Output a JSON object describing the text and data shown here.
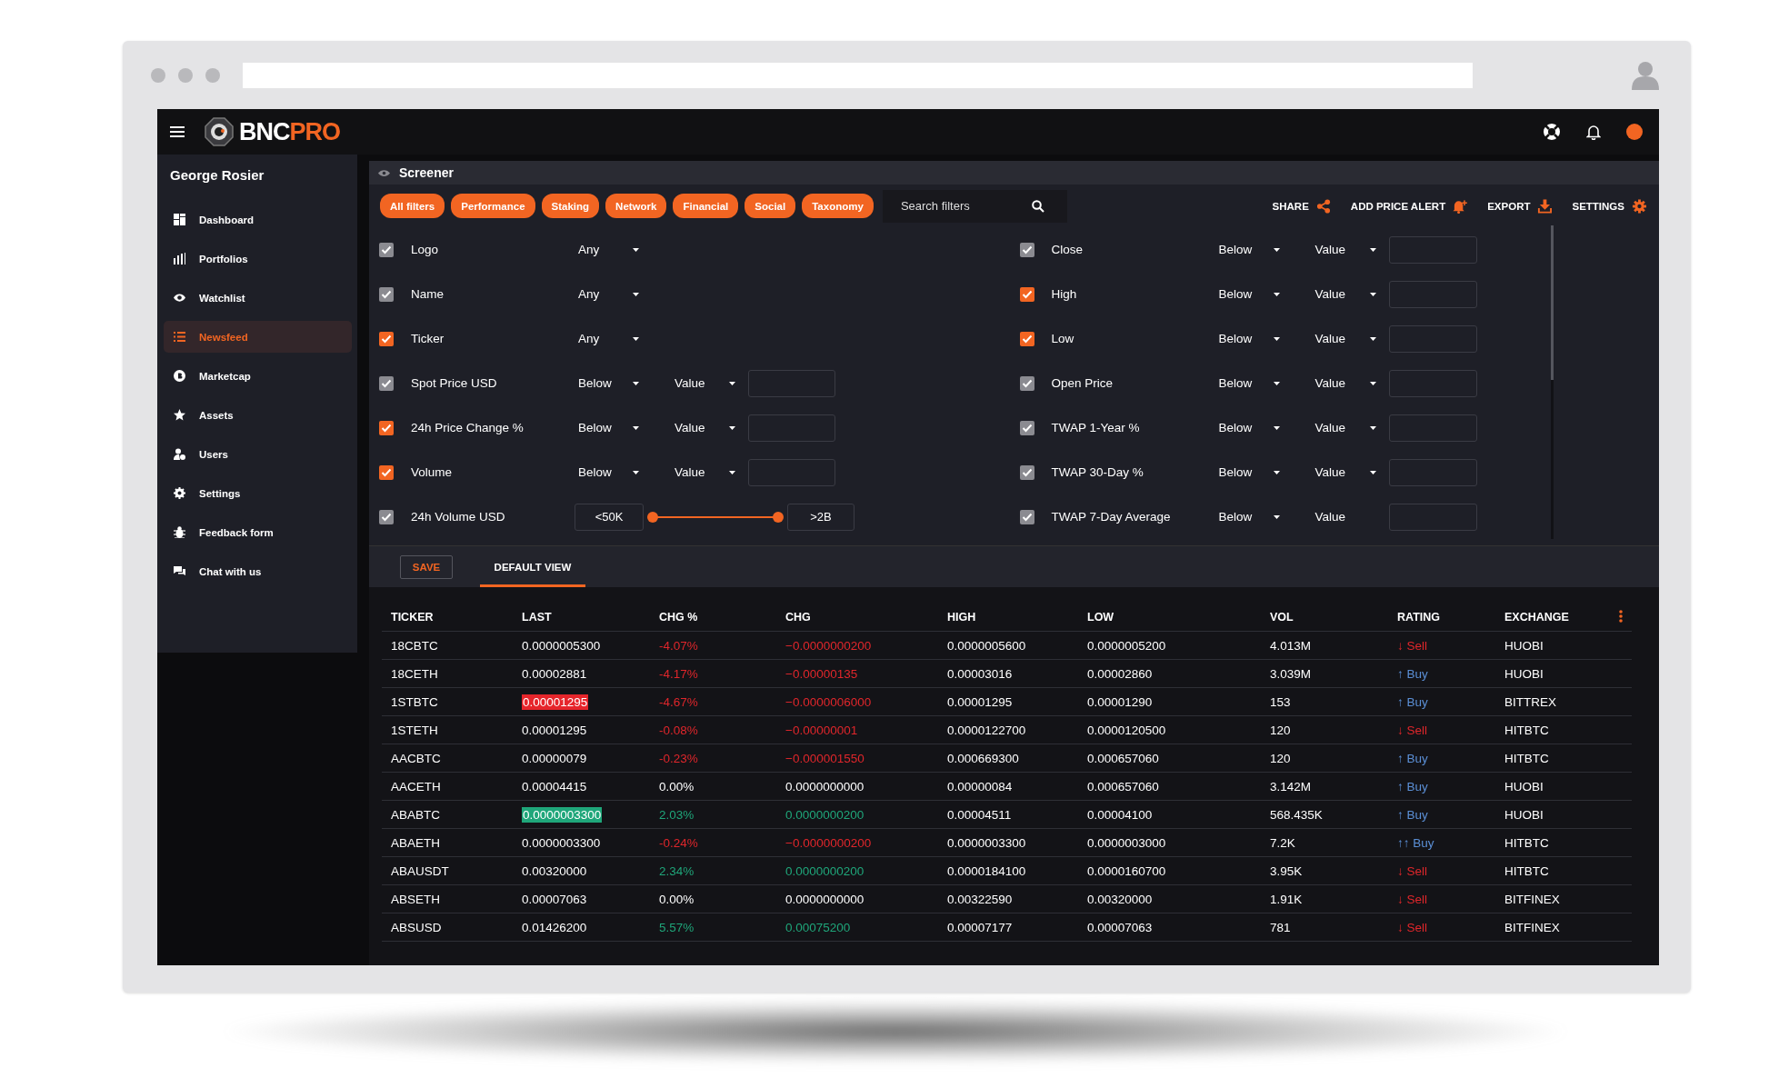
{
  "app": {
    "logo": {
      "primary": "BNC",
      "accent": "PRO"
    }
  },
  "sidebar": {
    "user": "George Rosier",
    "items": [
      {
        "label": "Dashboard",
        "selected": false
      },
      {
        "label": "Portfolios",
        "selected": false
      },
      {
        "label": "Watchlist",
        "selected": false
      },
      {
        "label": "Newsfeed",
        "selected": true
      },
      {
        "label": "Marketcap",
        "selected": false
      },
      {
        "label": "Assets",
        "selected": false
      },
      {
        "label": "Users",
        "selected": false
      },
      {
        "label": "Settings",
        "selected": false
      },
      {
        "label": "Feedback form",
        "selected": false
      },
      {
        "label": "Chat with us",
        "selected": false
      }
    ]
  },
  "screener": {
    "title": "Screener",
    "chips": [
      "All filters",
      "Performance",
      "Staking",
      "Network",
      "Financial",
      "Social",
      "Taxonomy"
    ],
    "search": {
      "placeholder": "Search filters"
    },
    "actions": [
      {
        "label": "SHARE"
      },
      {
        "label": "ADD PRICE ALERT"
      },
      {
        "label": "EXPORT"
      },
      {
        "label": "SETTINGS"
      }
    ],
    "filter_columns": [
      [
        {
          "label": "Logo",
          "checked": true,
          "color": "#8b8b91",
          "kind": "select",
          "op": "Any"
        },
        {
          "label": "Name",
          "checked": true,
          "color": "#8b8b91",
          "kind": "select",
          "op": "Any"
        },
        {
          "label": "Ticker",
          "checked": true,
          "color": "#f26522",
          "kind": "select",
          "op": "Any"
        },
        {
          "label": "Spot Price USD",
          "checked": true,
          "color": "#8b8b91",
          "kind": "compare",
          "op": "Below",
          "value": "Value",
          "value_dropdown": true
        },
        {
          "label": "24h Price Change %",
          "checked": true,
          "color": "#f26522",
          "kind": "compare",
          "op": "Below",
          "value": "Value",
          "value_dropdown": true
        },
        {
          "label": "Volume",
          "checked": true,
          "color": "#f26522",
          "kind": "compare",
          "op": "Below",
          "value": "Value",
          "value_dropdown": true
        },
        {
          "label": "24h Volume USD",
          "checked": true,
          "color": "#8b8b91",
          "kind": "range",
          "min": "<50K",
          "max": ">2B",
          "level": 1
        }
      ],
      [
        {
          "label": "Close",
          "checked": true,
          "color": "#8b8b91",
          "kind": "compare",
          "op": "Below",
          "value": "Value",
          "value_dropdown": true
        },
        {
          "label": "High",
          "checked": true,
          "color": "#f26522",
          "kind": "compare",
          "op": "Below",
          "value": "Value",
          "value_dropdown": true
        },
        {
          "label": "Low",
          "checked": true,
          "color": "#f26522",
          "kind": "compare",
          "op": "Below",
          "value": "Value",
          "value_dropdown": true
        },
        {
          "label": "Open Price",
          "checked": true,
          "color": "#8b8b91",
          "kind": "compare",
          "op": "Below",
          "value": "Value",
          "value_dropdown": true
        },
        {
          "label": "TWAP 1-Year %",
          "checked": true,
          "color": "#8b8b91",
          "kind": "compare",
          "op": "Below",
          "value": "Value",
          "value_dropdown": true
        },
        {
          "label": "TWAP 30-Day %",
          "checked": true,
          "color": "#8b8b91",
          "kind": "compare",
          "op": "Below",
          "value": "Value",
          "value_dropdown": true
        },
        {
          "label": "TWAP 7-Day Average",
          "checked": true,
          "color": "#8b8b91",
          "kind": "compare",
          "op": "Below",
          "value": "Value",
          "value_dropdown": false
        }
      ]
    ]
  },
  "views": {
    "save": "SAVE",
    "tabs": [
      {
        "label": "DEFAULT VIEW",
        "selected": true
      }
    ]
  },
  "table": {
    "columns": [
      "TICKER",
      "LAST",
      "CHG %",
      "CHG",
      "HIGH",
      "LOW",
      "VOL",
      "RATING",
      "EXCHANGE"
    ],
    "rows": [
      {
        "ticker": "18CBTC",
        "last": {
          "text": "0.0000005300",
          "highlighted": false
        },
        "chg_pct": {
          "text": "-4.07%",
          "color": "#e0262b"
        },
        "chg": {
          "text": "−0.0000000200",
          "color": "#e0262b"
        },
        "high": "0.0000005600",
        "low": "0.0000005200",
        "vol": "4.013M",
        "rating": {
          "text": "↓ Sell",
          "color": "#e0262b"
        },
        "exchange": "HUOBI"
      },
      {
        "ticker": "18CETH",
        "last": {
          "text": "0.00002881",
          "highlighted": false
        },
        "chg_pct": {
          "text": "-4.17%",
          "color": "#e0262b"
        },
        "chg": {
          "text": "−0.00000135",
          "color": "#e0262b"
        },
        "high": "0.00003016",
        "low": "0.00002860",
        "vol": "3.039M",
        "rating": {
          "text": "↑ Buy",
          "color": "#5b8fd6"
        },
        "exchange": "HUOBI"
      },
      {
        "ticker": "1STBTC",
        "last": {
          "text": "0.00001295",
          "highlighted": true,
          "color": "#e6252b"
        },
        "chg_pct": {
          "text": "-4.67%",
          "color": "#e0262b"
        },
        "chg": {
          "text": "−0.0000006000",
          "color": "#e0262b"
        },
        "high": "0.00001295",
        "low": "0.00001290",
        "vol": "153",
        "rating": {
          "text": "↑ Buy",
          "color": "#5b8fd6"
        },
        "exchange": "BITTREX"
      },
      {
        "ticker": "1STETH",
        "last": {
          "text": "0.00001295",
          "highlighted": false
        },
        "chg_pct": {
          "text": "-0.08%",
          "color": "#e0262b"
        },
        "chg": {
          "text": "−0.00000001",
          "color": "#e0262b"
        },
        "high": "0.0000122700",
        "low": "0.0000120500",
        "vol": "120",
        "rating": {
          "text": "↓ Sell",
          "color": "#e0262b"
        },
        "exchange": "HITBTC"
      },
      {
        "ticker": "AACBTC",
        "last": {
          "text": "0.00000079",
          "highlighted": false
        },
        "chg_pct": {
          "text": "-0.23%",
          "color": "#e0262b"
        },
        "chg": {
          "text": "−0.000001550",
          "color": "#e0262b"
        },
        "high": "0.000669300",
        "low": "0.000657060",
        "vol": "120",
        "rating": {
          "text": "↑ Buy",
          "color": "#5b8fd6"
        },
        "exchange": "HITBTC"
      },
      {
        "ticker": "AACETH",
        "last": {
          "text": "0.00004415",
          "highlighted": false
        },
        "chg_pct": {
          "text": "0.00%",
          "color": "#ffffff"
        },
        "chg": {
          "text": "0.0000000000",
          "color": "#ffffff"
        },
        "high": "0.00000084",
        "low": "0.000657060",
        "vol": "3.142M",
        "rating": {
          "text": "↑ Buy",
          "color": "#5b8fd6"
        },
        "exchange": "HUOBI"
      },
      {
        "ticker": "ABABTC",
        "last": {
          "text": "0.0000003300",
          "highlighted": true,
          "color": "#1fa67a"
        },
        "chg_pct": {
          "text": "2.03%",
          "color": "#1fa67a"
        },
        "chg": {
          "text": "0.0000000200",
          "color": "#1fa67a"
        },
        "high": "0.00004511",
        "low": "0.00004100",
        "vol": "568.435K",
        "rating": {
          "text": "↑ Buy",
          "color": "#5b8fd6"
        },
        "exchange": "HUOBI"
      },
      {
        "ticker": "ABAETH",
        "last": {
          "text": "0.0000003300",
          "highlighted": false
        },
        "chg_pct": {
          "text": "-0.24%",
          "color": "#e0262b"
        },
        "chg": {
          "text": "−0.0000000200",
          "color": "#e0262b"
        },
        "high": "0.0000003300",
        "low": "0.0000003000",
        "vol": "7.2K",
        "rating": {
          "text": "↑↑ Buy",
          "color": "#5b8fd6"
        },
        "exchange": "HITBTC"
      },
      {
        "ticker": "ABAUSDT",
        "last": {
          "text": "0.00320000",
          "highlighted": false
        },
        "chg_pct": {
          "text": "2.34%",
          "color": "#1fa67a"
        },
        "chg": {
          "text": "0.0000000200",
          "color": "#1fa67a"
        },
        "high": "0.0000184100",
        "low": "0.0000160700",
        "vol": "3.95K",
        "rating": {
          "text": "↓ Sell",
          "color": "#e0262b"
        },
        "exchange": "HITBTC"
      },
      {
        "ticker": "ABSETH",
        "last": {
          "text": "0.00007063",
          "highlighted": false
        },
        "chg_pct": {
          "text": "0.00%",
          "color": "#ffffff"
        },
        "chg": {
          "text": "0.0000000000",
          "color": "#ffffff"
        },
        "high": "0.00322590",
        "low": "0.00320000",
        "vol": "1.91K",
        "rating": {
          "text": "↓ Sell",
          "color": "#e0262b"
        },
        "exchange": "BITFINEX"
      },
      {
        "ticker": "ABSUSD",
        "last": {
          "text": "0.01426200",
          "highlighted": false
        },
        "chg_pct": {
          "text": "5.57%",
          "color": "#1fa67a"
        },
        "chg": {
          "text": "0.00075200",
          "color": "#1fa67a"
        },
        "high": "0.00007177",
        "low": "0.00007063",
        "vol": "781",
        "rating": {
          "text": "↓ Sell",
          "color": "#e0262b"
        },
        "exchange": "BITFINEX"
      }
    ]
  }
}
